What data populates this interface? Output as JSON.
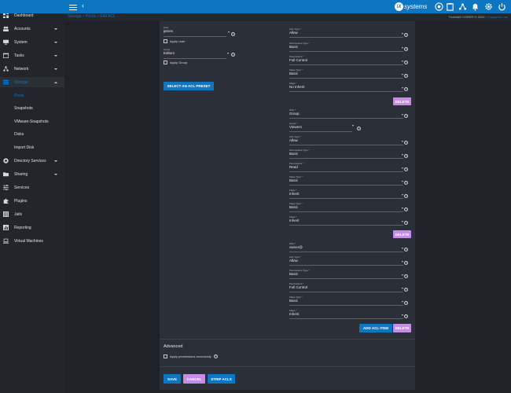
{
  "topbar": {
    "logo_mark": "iX",
    "logo_text": "systems"
  },
  "sidebar": {
    "items": [
      {
        "label": "Dashboard"
      },
      {
        "label": "Accounts"
      },
      {
        "label": "System"
      },
      {
        "label": "Tasks"
      },
      {
        "label": "Network"
      },
      {
        "label": "Storage"
      },
      {
        "label": "Directory Services"
      },
      {
        "label": "Sharing"
      },
      {
        "label": "Services"
      },
      {
        "label": "Plugins"
      },
      {
        "label": "Jails"
      },
      {
        "label": "Reporting"
      },
      {
        "label": "Virtual Machines"
      }
    ],
    "storage_sub": [
      {
        "label": "Pools"
      },
      {
        "label": "Snapshots"
      },
      {
        "label": "VMware-Snapshots"
      },
      {
        "label": "Disks"
      },
      {
        "label": "Import Disk"
      }
    ]
  },
  "breadcrumb": {
    "c1": "Storage",
    "sep": "›",
    "c2": "Pools",
    "c3": "Edit ACL"
  },
  "copyright": {
    "text": "TrueNAS CORE® © 2022 - ",
    "company": "iXsystems, Inc"
  },
  "owner": {
    "user_label": "User",
    "user_value": "james",
    "apply_user": "Apply User",
    "group_label": "Group",
    "group_value": "Editors",
    "apply_group": "Apply Group",
    "preset_button": "SELECT AN ACL PRESET"
  },
  "ace1": {
    "acl_type_label": "ACL Type *",
    "acl_type": "Allow",
    "perm_type_label": "Permissions Type *",
    "perm_type": "Basic",
    "perm_label": "Permissions *",
    "perm": "Full Control",
    "flags_type_label": "Flags Type *",
    "flags_type": "Basic",
    "flags_label": "Flags *",
    "flags": "No Inherit",
    "delete": "DELETE"
  },
  "ace2": {
    "who_label": "Who *",
    "who": "Group",
    "group_label": "Group *",
    "group": "Viewers",
    "acl_type_label": "ACL Type *",
    "acl_type": "Allow",
    "perm_type_label": "Permissions Type *",
    "perm_type": "Basic",
    "perm_label": "Permissions *",
    "perm": "Read",
    "flags_type_label": "Flags Type *",
    "flags_type": "Basic",
    "flags_label": "Flags *",
    "flags": "Inherit",
    "delete": "DELETE"
  },
  "ace3": {
    "who_label": "Who *",
    "who": "owner@",
    "acl_type_label": "ACL Type *",
    "acl_type": "Allow",
    "perm_type_label": "Permissions Type *",
    "perm_type": "Basic",
    "perm_label": "Permissions *",
    "perm": "Full Control",
    "flags_type_label": "Flags Type *",
    "flags_type": "Basic",
    "flags_label": "Flags *",
    "flags": "Inherit",
    "add": "ADD ACL ITEM",
    "delete": "DELETE"
  },
  "advanced": {
    "title": "Advanced",
    "recursive": "Apply permissions recursively"
  },
  "actions": {
    "save": "SAVE",
    "cancel": "CANCEL",
    "strip": "STRIP ACLS"
  },
  "colors": {
    "primary": "#0d76c2",
    "delete": "#c48ee2",
    "card": "#2b3038",
    "sidebar": "#22262c"
  }
}
